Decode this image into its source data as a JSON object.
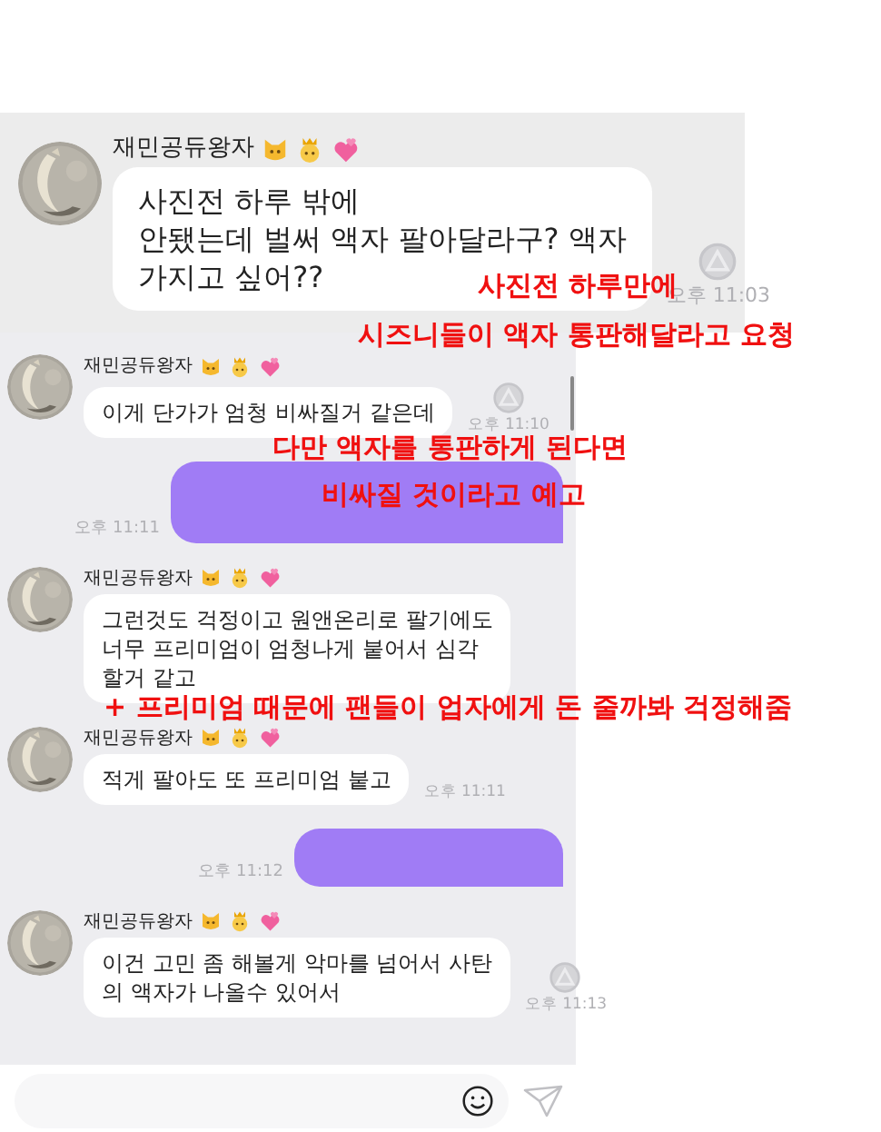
{
  "panels": [
    {
      "messages": [
        {
          "kind": "received",
          "sender": "재민공듀왕자",
          "lines": [
            "사진전 하루 밖에",
            "안됐는데 벌써 액자 팔아달라구? 액자",
            "가지고 싶어??"
          ],
          "time": "오후 11:03",
          "badge": true
        }
      ]
    },
    {
      "messages": [
        {
          "kind": "received",
          "sender": "재민공듀왕자",
          "lines": [
            "이게 단가가 엄청 비싸질거 같은데"
          ],
          "time": "오후 11:10",
          "badge": true
        },
        {
          "kind": "sent",
          "time": "오후 11:11"
        },
        {
          "kind": "received",
          "sender": "재민공듀왕자",
          "lines": [
            "그런것도 걱정이고 원앤온리로 팔기에도",
            "너무 프리미엄이 엄청나게 붙어서 심각",
            "할거 같고"
          ],
          "badge": false
        },
        {
          "kind": "received",
          "sender": "재민공듀왕자",
          "lines": [
            "적게 팔아도 또 프리미엄 붙고"
          ],
          "time": "오후 11:11",
          "badge": false
        },
        {
          "kind": "sent",
          "time": "오후 11:12"
        },
        {
          "kind": "received",
          "sender": "재민공듀왕자",
          "lines": [
            "이건 고민 좀 해볼게 악마를 넘어서 사탄",
            "의 액자가 나올수 있어서"
          ],
          "time": "오후 11:13",
          "badge": true
        }
      ]
    }
  ],
  "annotations": [
    "사진전 하루만에",
    "시즈니들이 액자 통판해달라고 요청",
    "다만 액자를 통판하게 된다면",
    "비싸질 것이라고 예고",
    "+ 프리미엄 때문에 팬들이 업자에게 돈 줄까봐 걱정해줌"
  ]
}
